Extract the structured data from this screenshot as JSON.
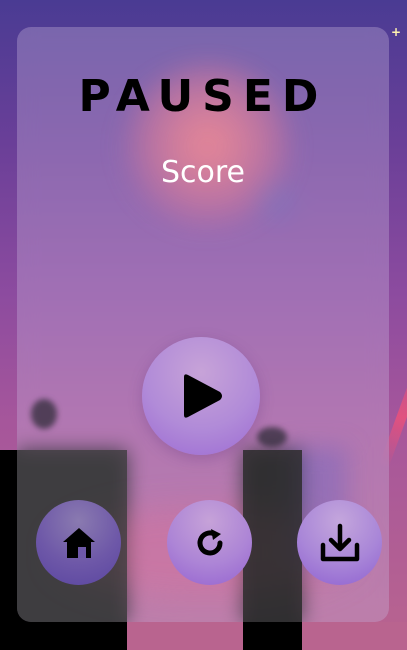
{
  "pause_menu": {
    "title": "PAUSED",
    "score_label": "Score"
  },
  "buttons": {
    "play": {
      "icon": "play-icon"
    },
    "home": {
      "icon": "home-icon"
    },
    "restart": {
      "icon": "restart-icon"
    },
    "download": {
      "icon": "download-icon"
    }
  },
  "colors": {
    "title": "#000000",
    "score_label": "#ffffff",
    "accent_purple": "#9c6ad3",
    "sparkle": "#fff3b0"
  },
  "decor": {
    "sparkle": "+"
  }
}
